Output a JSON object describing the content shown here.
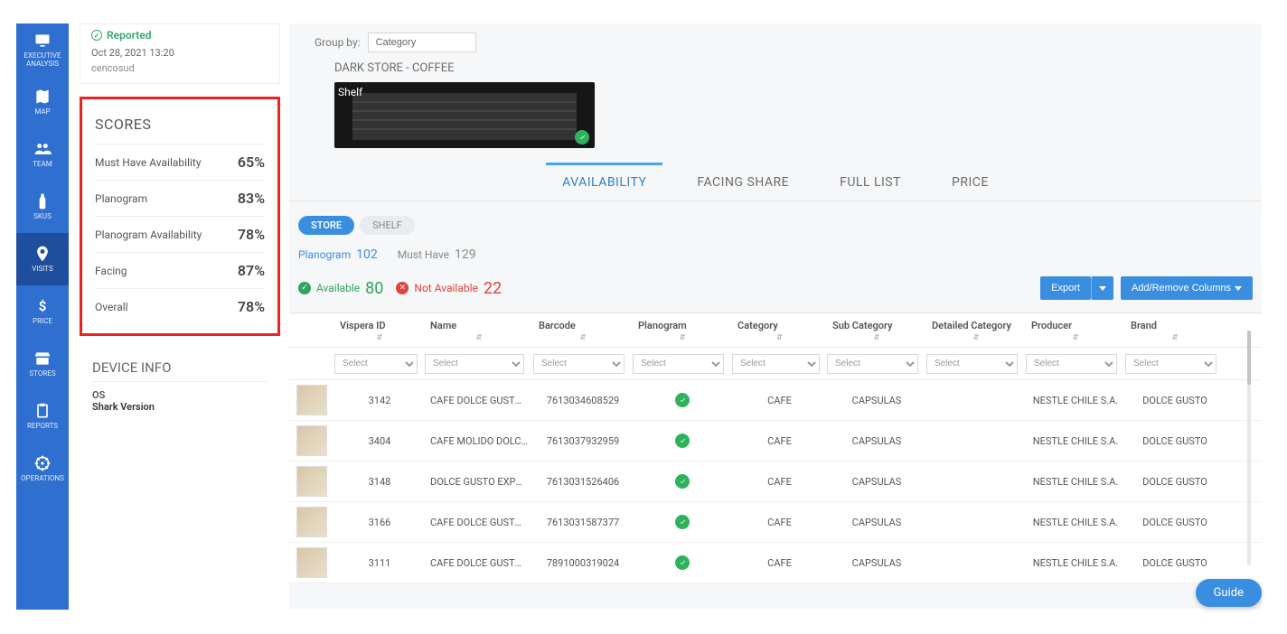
{
  "sidebar": {
    "items": [
      {
        "id": "executive",
        "label": "EXECUTIVE ANALYSIS",
        "icon": "monitor"
      },
      {
        "id": "map",
        "label": "MAP",
        "icon": "map"
      },
      {
        "id": "team",
        "label": "TEAM",
        "icon": "people"
      },
      {
        "id": "skus",
        "label": "SKUS",
        "icon": "bottle"
      },
      {
        "id": "visits",
        "label": "VISITS",
        "icon": "pin"
      },
      {
        "id": "price",
        "label": "PRICE",
        "icon": "dollar"
      },
      {
        "id": "stores",
        "label": "STORES",
        "icon": "store"
      },
      {
        "id": "reports",
        "label": "REPORTS",
        "icon": "clipboard"
      },
      {
        "id": "operations",
        "label": "OPERATIONS",
        "icon": "wheel"
      }
    ],
    "active": "visits"
  },
  "left": {
    "reported": {
      "status": "Reported",
      "time": "Oct 28, 2021 13:20",
      "user": "cencosud"
    },
    "scores": {
      "title": "SCORES",
      "rows": [
        {
          "label": "Must Have Availability",
          "value": "65%"
        },
        {
          "label": "Planogram",
          "value": "83%"
        },
        {
          "label": "Planogram Availability",
          "value": "78%"
        },
        {
          "label": "Facing",
          "value": "87%"
        },
        {
          "label": "Overall",
          "value": "78%"
        }
      ]
    },
    "device": {
      "title": "DEVICE INFO",
      "os": "OS",
      "shark": "Shark Version"
    }
  },
  "main": {
    "groupby_label": "Group by:",
    "groupby_value": "Category",
    "section": "DARK STORE - COFFEE",
    "shelf_label": "Shelf",
    "tabs": [
      {
        "id": "availability",
        "label": "AVAILABILITY"
      },
      {
        "id": "facing",
        "label": "FACING SHARE"
      },
      {
        "id": "fulllist",
        "label": "FULL LIST"
      },
      {
        "id": "price",
        "label": "PRICE"
      }
    ],
    "active_tab": "availability",
    "pills": [
      {
        "id": "store",
        "label": "STORE"
      },
      {
        "id": "shelf",
        "label": "SHELF"
      }
    ],
    "active_pill": "store",
    "subtabs": [
      {
        "id": "planogram",
        "label": "Planogram",
        "count": "102"
      },
      {
        "id": "musthave",
        "label": "Must Have",
        "count": "129"
      }
    ],
    "active_subtab": "planogram",
    "status": {
      "available": {
        "label": "Available",
        "count": "80"
      },
      "not_available": {
        "label": "Not Available",
        "count": "22"
      }
    },
    "buttons": {
      "export": "Export",
      "addremove": "Add/Remove Columns"
    },
    "columns": [
      "Vispera ID",
      "Name",
      "Barcode",
      "Planogram",
      "Category",
      "Sub Category",
      "Detailed Category",
      "Producer",
      "Brand"
    ],
    "filter_placeholder": "Select",
    "rows": [
      {
        "id": "3142",
        "name": "CAFE DOLCE GUSTO ...",
        "barcode": "7613034608529",
        "planogram": true,
        "category": "CAFE",
        "sub": "CAPSULAS",
        "detailed": "",
        "producer": "NESTLE CHILE S.A.",
        "brand": "DOLCE GUSTO"
      },
      {
        "id": "3404",
        "name": "CAFE MOLIDO DOLC...",
        "barcode": "7613037932959",
        "planogram": true,
        "category": "CAFE",
        "sub": "CAPSULAS",
        "detailed": "",
        "producer": "NESTLE CHILE S.A.",
        "brand": "DOLCE GUSTO"
      },
      {
        "id": "3148",
        "name": "DOLCE GUSTO EXPR...",
        "barcode": "7613031526406",
        "planogram": true,
        "category": "CAFE",
        "sub": "CAPSULAS",
        "detailed": "",
        "producer": "NESTLE CHILE S.A.",
        "brand": "DOLCE GUSTO"
      },
      {
        "id": "3166",
        "name": "CAFE DOLCE GUSTO ...",
        "barcode": "7613031587377",
        "planogram": true,
        "category": "CAFE",
        "sub": "CAPSULAS",
        "detailed": "",
        "producer": "NESTLE CHILE S.A.",
        "brand": "DOLCE GUSTO"
      },
      {
        "id": "3111",
        "name": "CAFE DOLCE GUSTO ...",
        "barcode": "7891000319024",
        "planogram": true,
        "category": "CAFE",
        "sub": "CAPSULAS",
        "detailed": "",
        "producer": "NESTLE CHILE S.A.",
        "brand": "DOLCE GUSTO"
      }
    ]
  },
  "guide": "Guide"
}
